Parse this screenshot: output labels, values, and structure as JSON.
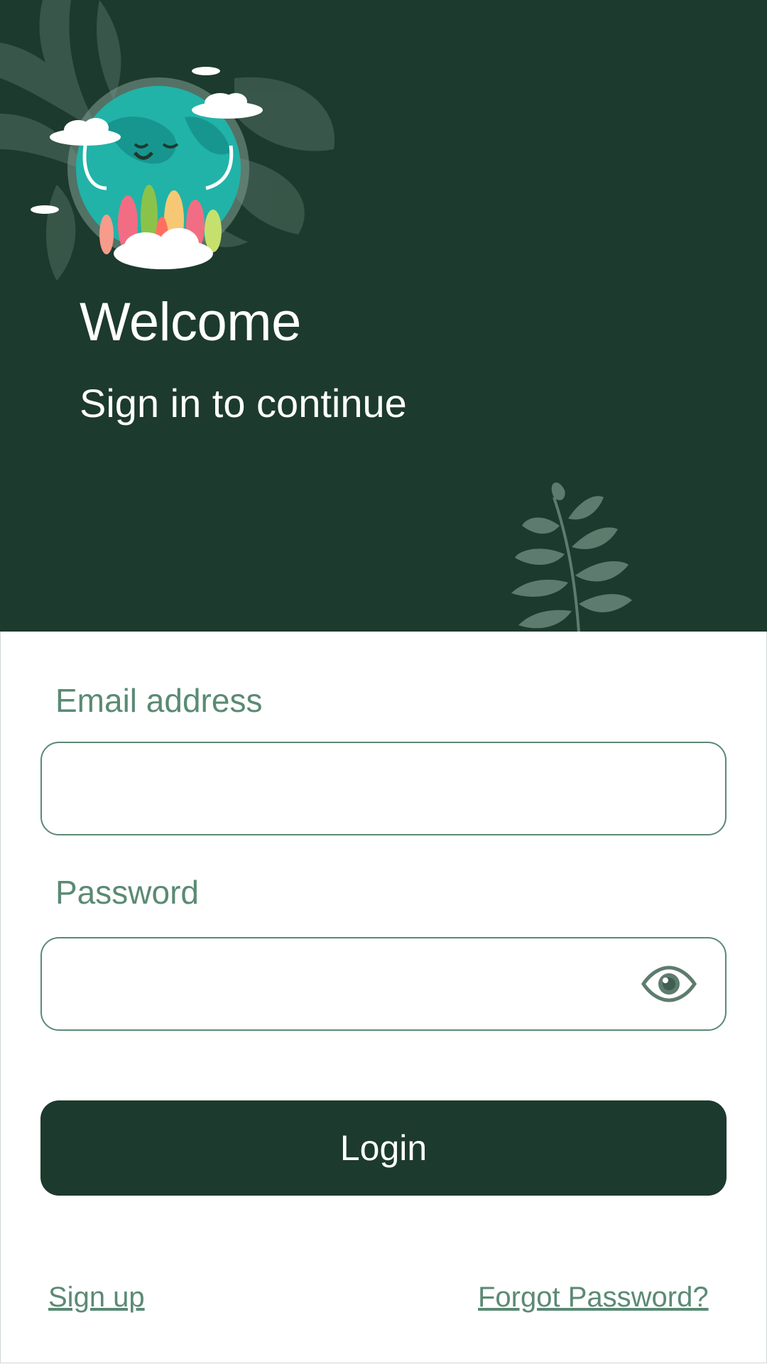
{
  "header": {
    "title": "Welcome",
    "subtitle": "Sign in to continue"
  },
  "form": {
    "email_label": "Email address",
    "email_value": "",
    "password_label": "Password",
    "password_value": "",
    "login_label": "Login",
    "signup_label": "Sign up",
    "forgot_label": "Forgot Password?"
  },
  "colors": {
    "primary_dark": "#1c3a2d",
    "accent": "#5b8a74",
    "background": "#ffffff"
  },
  "icons": [
    "earth-illustration",
    "leaf-decoration",
    "eye-icon"
  ]
}
